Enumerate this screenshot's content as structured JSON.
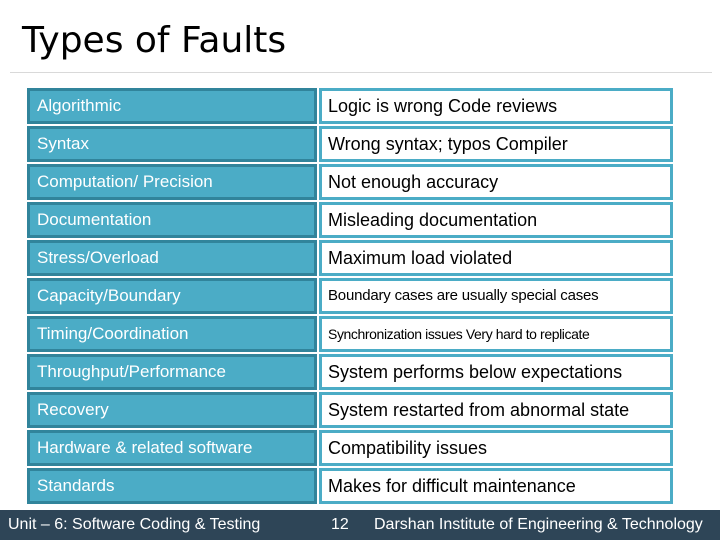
{
  "slide": {
    "title": "Types of Faults",
    "rows": [
      {
        "fault": "Algorithmic",
        "description": "Logic is wrong Code reviews"
      },
      {
        "fault": "Syntax",
        "description": "Wrong syntax; typos Compiler"
      },
      {
        "fault": "Computation/ Precision",
        "description": "Not enough accuracy"
      },
      {
        "fault": "Documentation",
        "description": "Misleading documentation"
      },
      {
        "fault": "Stress/Overload",
        "description": "Maximum load violated"
      },
      {
        "fault": "Capacity/Boundary",
        "description": "Boundary cases are usually special cases"
      },
      {
        "fault": "Timing/Coordination",
        "description": "Synchronization issues Very hard to replicate"
      },
      {
        "fault": "Throughput/Performance",
        "description": "System performs below expectations"
      },
      {
        "fault": "Recovery",
        "description": "System restarted from abnormal state"
      },
      {
        "fault": "Hardware & related software",
        "description": "Compatibility issues"
      },
      {
        "fault": "Standards",
        "description": "Makes for difficult maintenance"
      }
    ]
  },
  "footer": {
    "unit": "Unit – 6: Software Coding & Testing",
    "page_number": "12",
    "institute": "Darshan Institute of Engineering & Technology"
  },
  "colors": {
    "fault_cell_fill": "#4bacc6",
    "fault_cell_border": "#31849b",
    "footer_bg": "#2e4557"
  }
}
